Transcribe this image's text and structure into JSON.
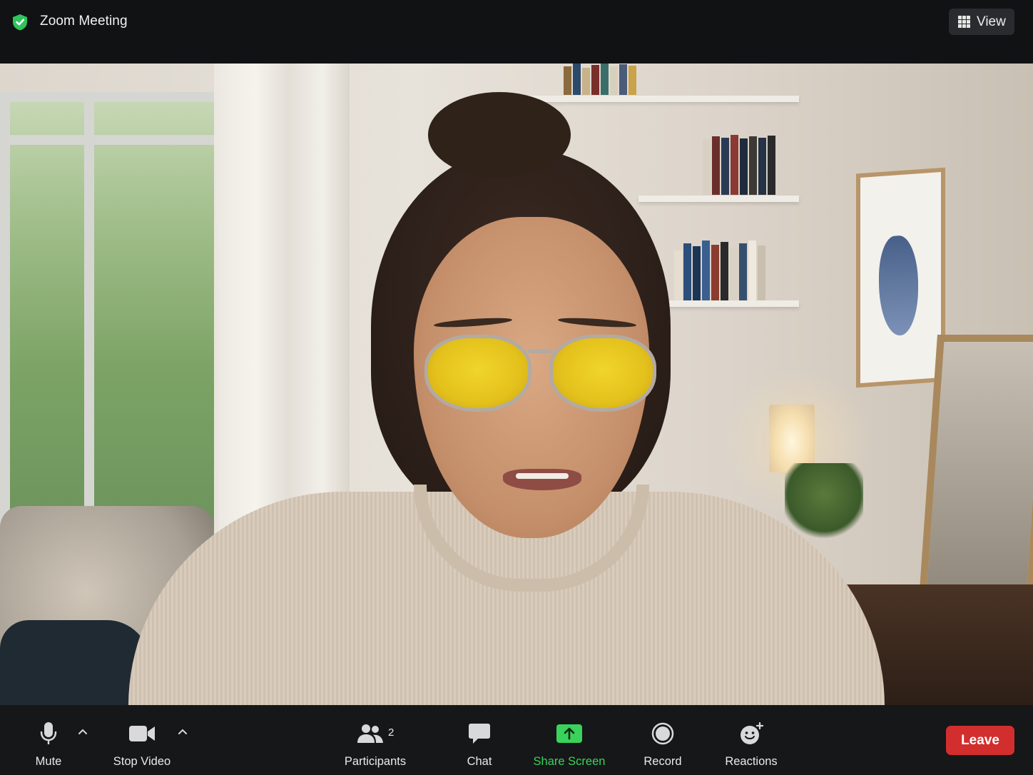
{
  "header": {
    "title": "Zoom Meeting",
    "security_icon": "shield-check-icon",
    "view_button": {
      "label": "View",
      "icon": "grid-icon"
    }
  },
  "video": {
    "participant_description_icon": "video-feed"
  },
  "toolbar": {
    "mute": {
      "label": "Mute",
      "icon": "microphone-icon"
    },
    "stop_video": {
      "label": "Stop Video",
      "icon": "video-camera-icon"
    },
    "participants": {
      "label": "Participants",
      "icon": "people-icon",
      "count": "2"
    },
    "chat": {
      "label": "Chat",
      "icon": "chat-bubble-icon"
    },
    "share_screen": {
      "label": "Share Screen",
      "icon": "share-arrow-icon"
    },
    "record": {
      "label": "Record",
      "icon": "record-icon"
    },
    "reactions": {
      "label": "Reactions",
      "icon": "smiley-add-icon"
    },
    "leave": {
      "label": "Leave"
    }
  },
  "colors": {
    "share_screen_green": "#3ad25a",
    "leave_red": "#d22e2e",
    "toolbar_bg": "#161719",
    "security_green": "#2ec55a"
  }
}
